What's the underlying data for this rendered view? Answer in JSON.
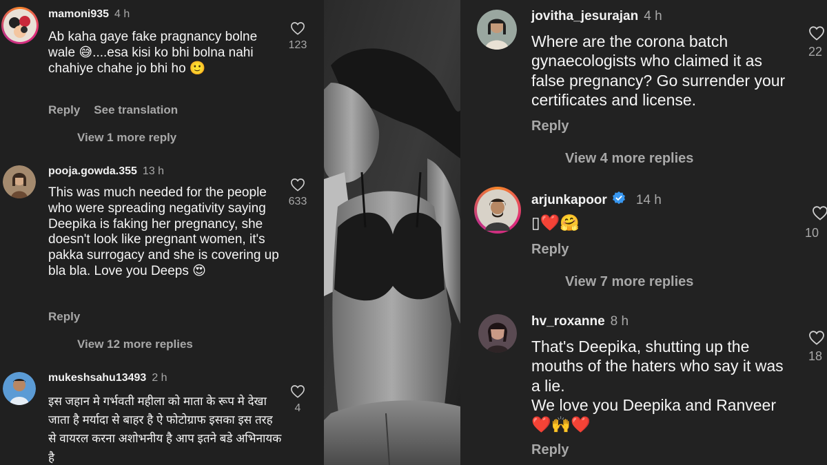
{
  "left_panel": {
    "comments": [
      {
        "username": "mamoni935",
        "time": "4 h",
        "text": "Ab kaha gaye fake pragnancy bolne wale 😅....esa kisi ko bhi bolna nahi chahiye chahe jo bhi ho 🙂",
        "reply_label": "Reply",
        "translate_label": "See translation",
        "likes": "123",
        "view_replies": "View 1 more reply"
      },
      {
        "username": "pooja.gowda.355",
        "time": "13 h",
        "text": "This was much needed for the people who were spreading negativity saying Deepika is faking her pregnancy, she doesn't look like pregnant women, it's pakka surrogacy and she is covering up bla bla. Love you Deeps 😍",
        "reply_label": "Reply",
        "likes": "633",
        "view_replies": "View 12 more replies"
      },
      {
        "username": "mukeshsahu13493",
        "time": "2 h",
        "text": "इस जहान मे गर्भवती महीला को माता के रूप मे देखा जाता है मर्यादा से बाहर है ऐ फोटोग्राफ इसका इस तरह से वायरल करना अशोभनीय है आप इतने बडे अभिनायक है",
        "likes": "4"
      }
    ]
  },
  "right_panel": {
    "comments": [
      {
        "username": "jovitha_jesurajan",
        "time": "4 h",
        "text": "Where are the corona batch gynaecologists who claimed it as false pregnancy? Go surrender your certificates and license.",
        "reply_label": "Reply",
        "likes": "22",
        "view_replies": "View 4 more replies"
      },
      {
        "username": "arjunkapoor",
        "time": "14 h",
        "verified": true,
        "text": "▯❤️🤗",
        "reply_label": "Reply",
        "likes": "10",
        "view_replies": "View 7 more replies"
      },
      {
        "username": "hv_roxanne",
        "time": "8 h",
        "text": "That's Deepika, shutting up the mouths of the haters who say it was a lie.\nWe love you Deepika and Ranveer\n❤️🙌❤️",
        "reply_label": "Reply",
        "likes": "18"
      }
    ]
  },
  "icons": {
    "like": "heart-outline-icon",
    "verified": "verified-badge-icon",
    "avatar_ring": "story-ring"
  },
  "colors": {
    "background_left": "#202020",
    "background_right": "#222222",
    "muted_text": "#a8a8a8",
    "verified_blue": "#3897f0",
    "story_ring_start": "#f58529",
    "story_ring_end": "#c13584"
  }
}
